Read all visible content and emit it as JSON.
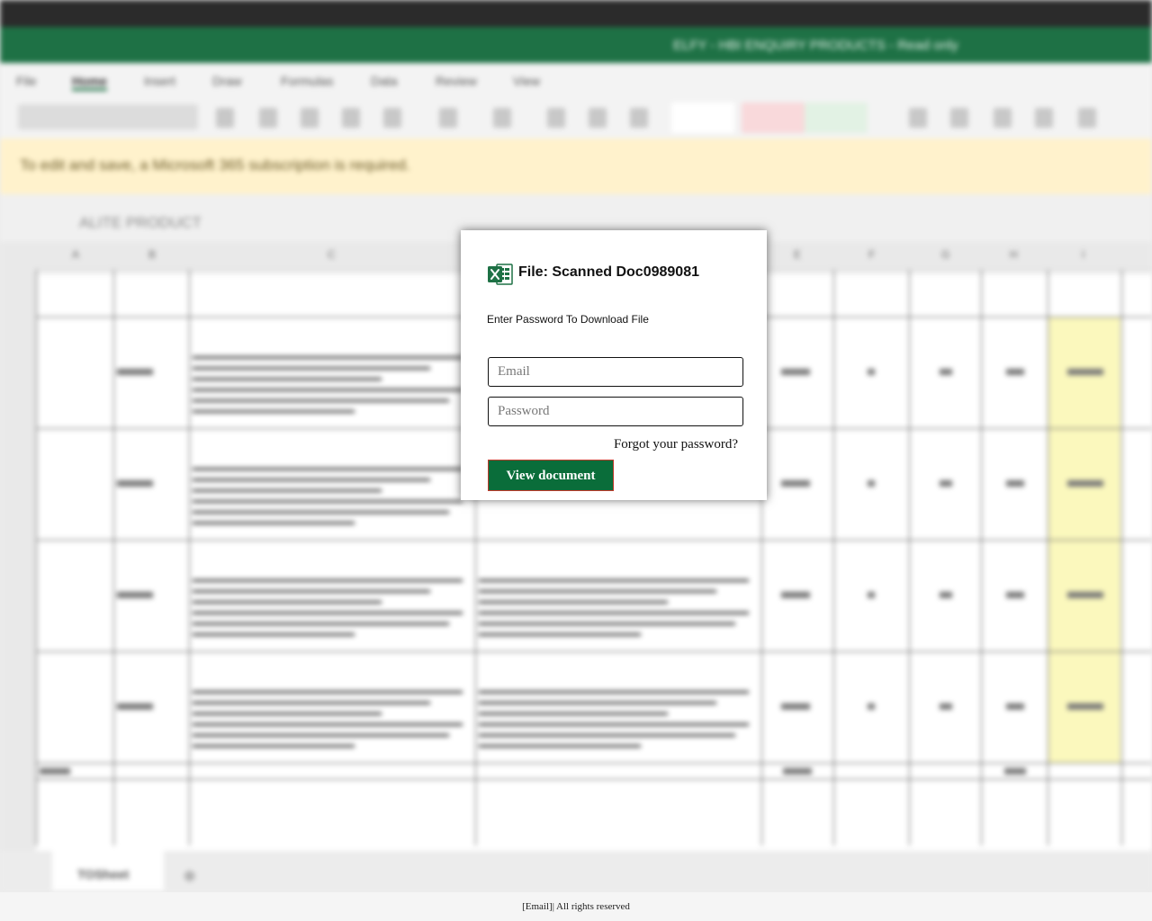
{
  "window": {
    "title": "ELFY - HBI ENQUIRY PRODUCTS - Read only"
  },
  "ribbon": {
    "tabs": [
      "File",
      "Home",
      "Insert",
      "Draw",
      "Formulas",
      "Data",
      "Review",
      "View"
    ],
    "selected_tab": "Home"
  },
  "banner": {
    "text": "To edit and save, a Microsoft 365 subscription is required."
  },
  "formula_bar": {
    "value": "ALITE PRODUCT"
  },
  "sheet": {
    "tab_name": "TOSheet"
  },
  "colors": {
    "excel_green": "#1e7145",
    "button_green": "#0a6d3a",
    "banner_yellow": "#fff2cc",
    "button_border": "#c0392b"
  },
  "modal": {
    "title": "File: Scanned Doc0989081",
    "subtitle": "Enter Password To Download File",
    "logo_icon": "excel-logo-icon",
    "email_placeholder": "Email",
    "password_placeholder": "Password",
    "forgot_label": "Forgot your password?",
    "submit_label": "View document"
  },
  "footer": {
    "text": "[Email]| All rights reserved"
  }
}
